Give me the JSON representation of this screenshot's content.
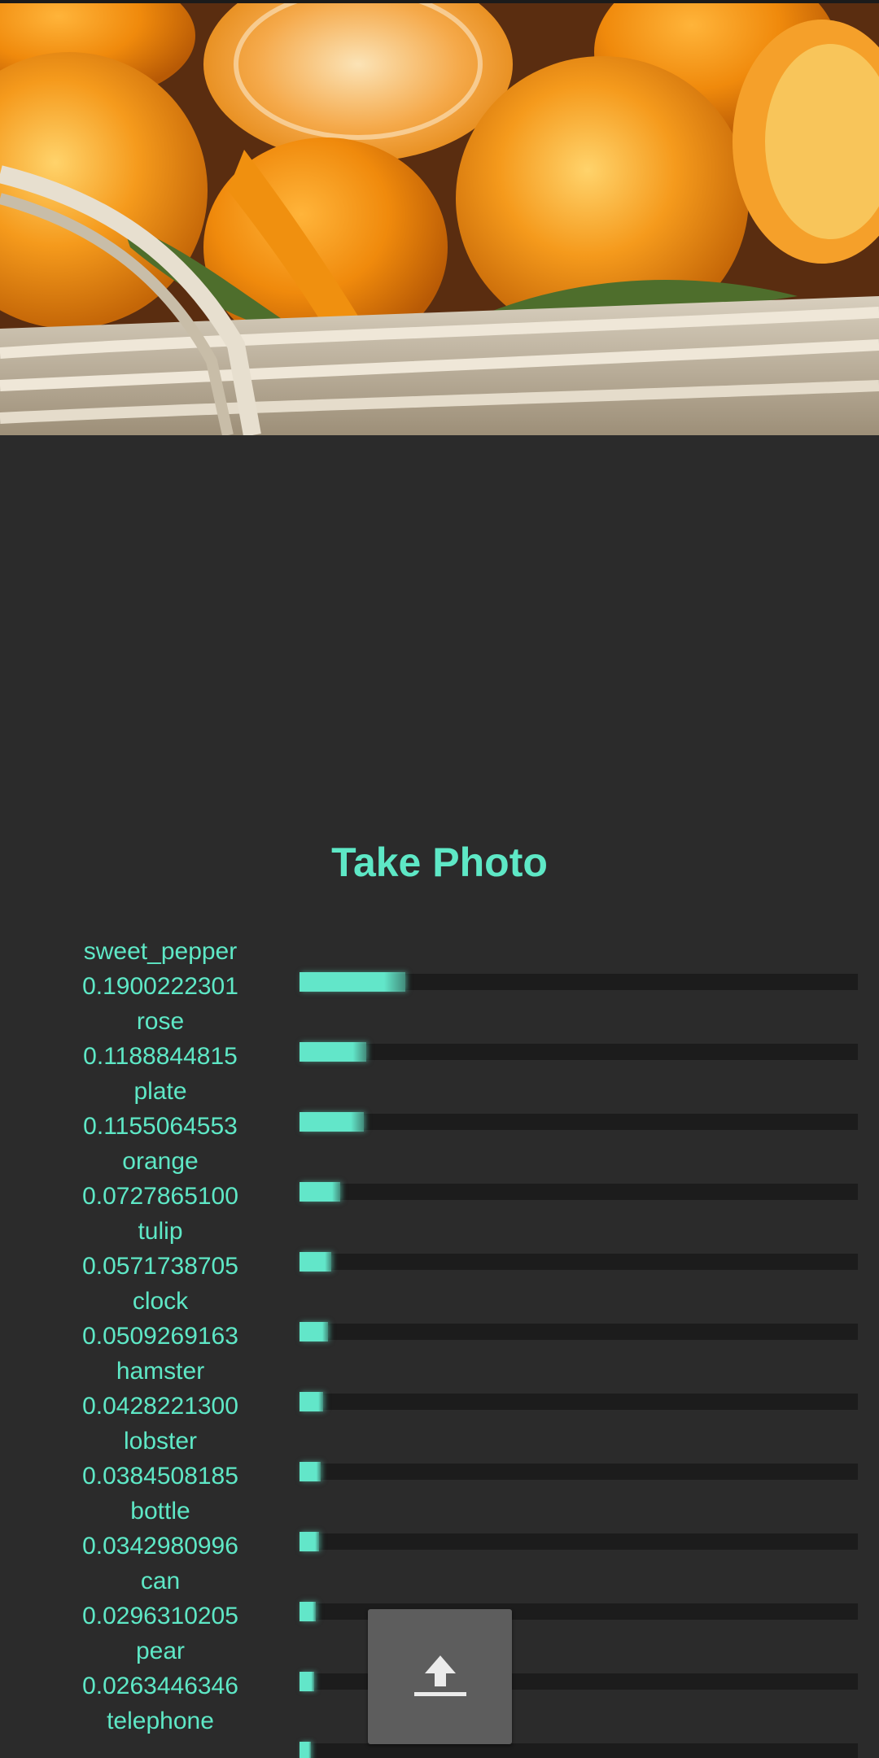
{
  "photo": {
    "subject": "oranges-in-basket"
  },
  "actions": {
    "take_photo_label": "Take Photo",
    "upload_icon": "upload-icon"
  },
  "predictions": [
    {
      "label": "sweet_pepper",
      "score_text": "0.1900222301",
      "score": 0.1900222301
    },
    {
      "label": "rose",
      "score_text": "0.1188844815",
      "score": 0.1188844815
    },
    {
      "label": "plate",
      "score_text": "0.1155064553",
      "score": 0.1155064553
    },
    {
      "label": "orange",
      "score_text": "0.0727865100",
      "score": 0.07278651
    },
    {
      "label": "tulip",
      "score_text": "0.0571738705",
      "score": 0.0571738705
    },
    {
      "label": "clock",
      "score_text": "0.0509269163",
      "score": 0.0509269163
    },
    {
      "label": "hamster",
      "score_text": "0.0428221300",
      "score": 0.04282213
    },
    {
      "label": "lobster",
      "score_text": "0.0384508185",
      "score": 0.0384508185
    },
    {
      "label": "bottle",
      "score_text": "0.0342980996",
      "score": 0.0342980996
    },
    {
      "label": "can",
      "score_text": "0.0296310205",
      "score": 0.0296310205
    },
    {
      "label": "pear",
      "score_text": "0.0263446346",
      "score": 0.0263446346
    },
    {
      "label": "telephone",
      "score_text": "",
      "score": 0.02
    }
  ],
  "colors": {
    "accent": "#5ee8c6",
    "background": "#2b2b2b",
    "track": "#1c1c1c",
    "button": "#5d5d5d"
  }
}
